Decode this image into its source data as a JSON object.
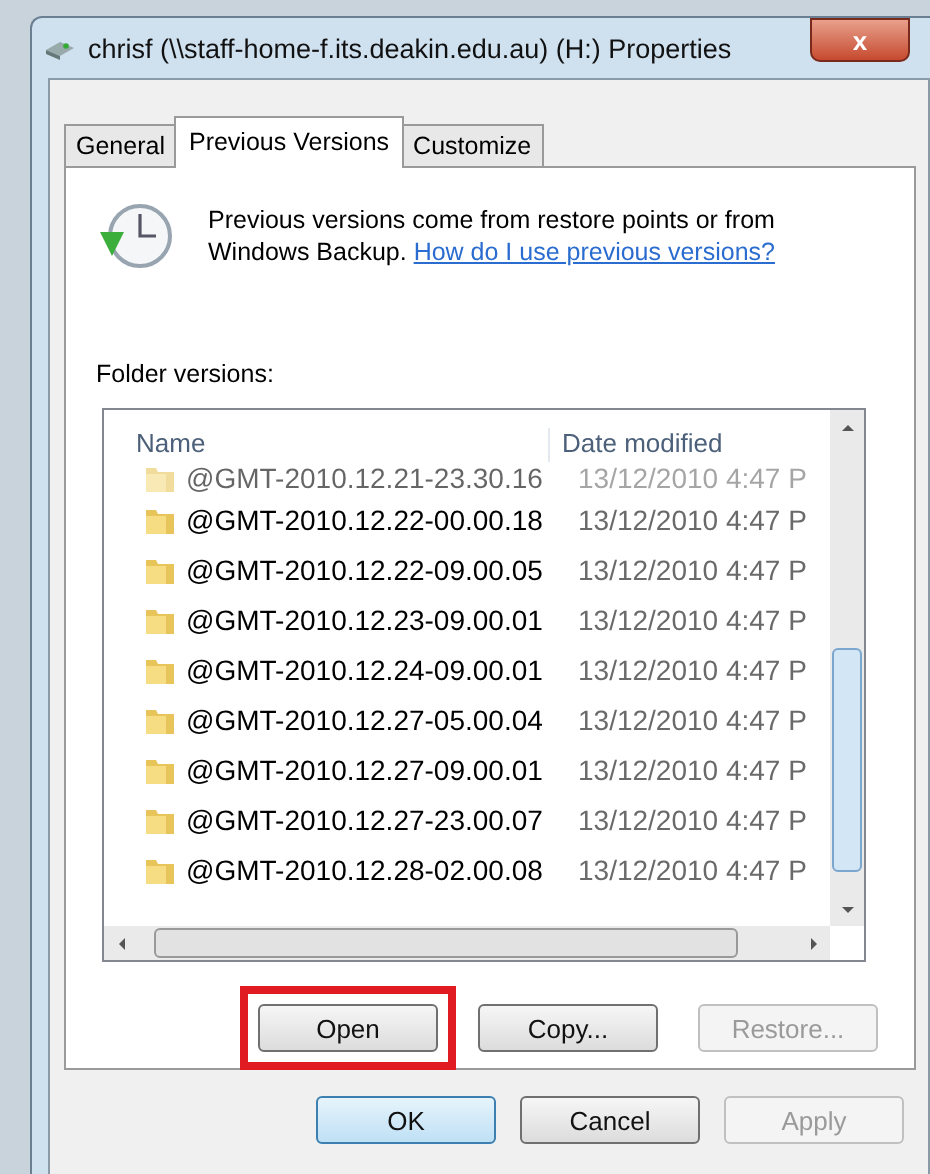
{
  "window": {
    "title": "chrisf (\\\\staff-home-f.its.deakin.edu.au) (H:) Properties",
    "close": "x"
  },
  "tabs": [
    {
      "label": "General",
      "selected": false
    },
    {
      "label": "Previous Versions",
      "selected": true
    },
    {
      "label": "Customize",
      "selected": false
    }
  ],
  "intro": {
    "text": "Previous versions come from restore points or from Windows Backup.",
    "link": "How do I use previous versions?"
  },
  "folder_versions": {
    "label": "Folder versions:",
    "columns": [
      "Name",
      "Date modified"
    ],
    "rows": [
      {
        "name": "@GMT-2010.12.21-23.30.16",
        "date": "13/12/2010 4:47 P",
        "partial": true
      },
      {
        "name": "@GMT-2010.12.22-00.00.18",
        "date": "13/12/2010 4:47 P",
        "partial": false
      },
      {
        "name": "@GMT-2010.12.22-09.00.05",
        "date": "13/12/2010 4:47 P",
        "partial": false
      },
      {
        "name": "@GMT-2010.12.23-09.00.01",
        "date": "13/12/2010 4:47 P",
        "partial": false
      },
      {
        "name": "@GMT-2010.12.24-09.00.01",
        "date": "13/12/2010 4:47 P",
        "partial": false
      },
      {
        "name": "@GMT-2010.12.27-05.00.04",
        "date": "13/12/2010 4:47 P",
        "partial": false
      },
      {
        "name": "@GMT-2010.12.27-09.00.01",
        "date": "13/12/2010 4:47 P",
        "partial": false
      },
      {
        "name": "@GMT-2010.12.27-23.00.07",
        "date": "13/12/2010 4:47 P",
        "partial": false
      },
      {
        "name": "@GMT-2010.12.28-02.00.08",
        "date": "13/12/2010 4:47 P",
        "partial": false
      }
    ]
  },
  "actions": [
    {
      "label": "Open",
      "disabled": false,
      "highlighted": true
    },
    {
      "label": "Copy...",
      "disabled": false,
      "highlighted": false
    },
    {
      "label": "Restore...",
      "disabled": true,
      "highlighted": false
    }
  ],
  "buttons": [
    {
      "label": "OK",
      "disabled": false,
      "default": true
    },
    {
      "label": "Cancel",
      "disabled": false,
      "default": false
    },
    {
      "label": "Apply",
      "disabled": true,
      "default": false
    }
  ]
}
